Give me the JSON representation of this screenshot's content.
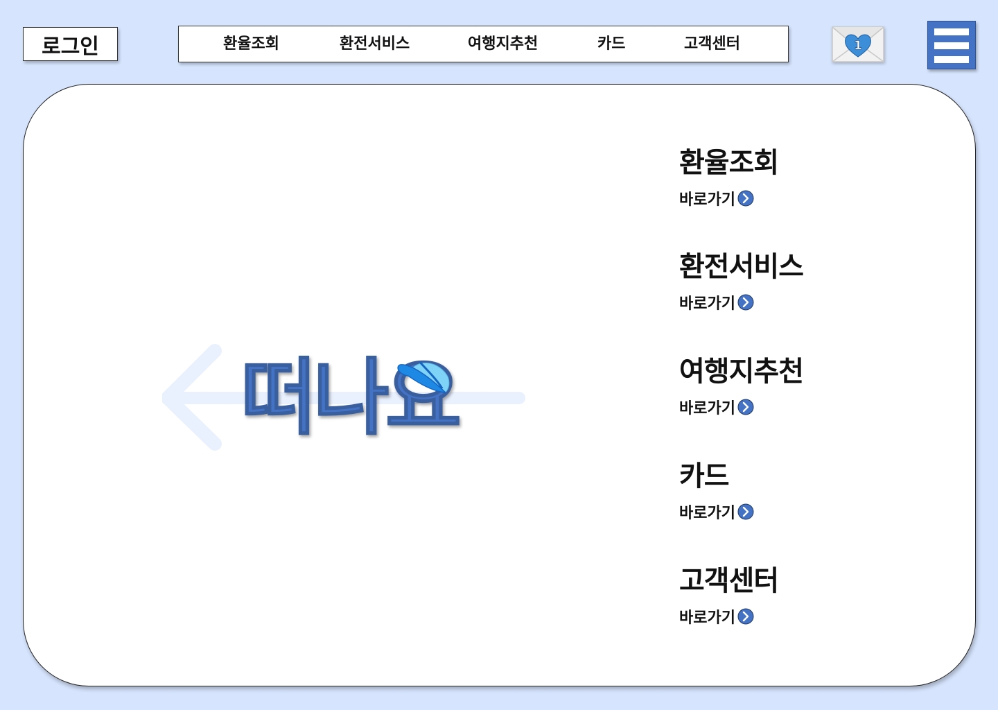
{
  "header": {
    "login_label": "로그인",
    "nav": [
      "환율조회",
      "환전서비스",
      "여행지추천",
      "카드",
      "고객센터"
    ],
    "mail_badge": "1",
    "menu_icon": "hamburger-menu-icon"
  },
  "hero": {
    "title": "떠나요",
    "icons": [
      "arrow-left-icon",
      "cap-icon"
    ]
  },
  "quick_links": {
    "items": [
      {
        "title": "환율조회",
        "link": "바로가기"
      },
      {
        "title": "환전서비스",
        "link": "바로가기"
      },
      {
        "title": "여행지추천",
        "link": "바로가기"
      },
      {
        "title": "카드",
        "link": "바로가기"
      },
      {
        "title": "고객센터",
        "link": "바로가기"
      }
    ],
    "link_icon": "chevron-right-circle-icon"
  },
  "colors": {
    "background": "#d6e4fd",
    "accent": "#4472c4",
    "arrow": "#e9f0fe",
    "heart": "#3c8ed8",
    "cap": "#4fc3f7"
  }
}
